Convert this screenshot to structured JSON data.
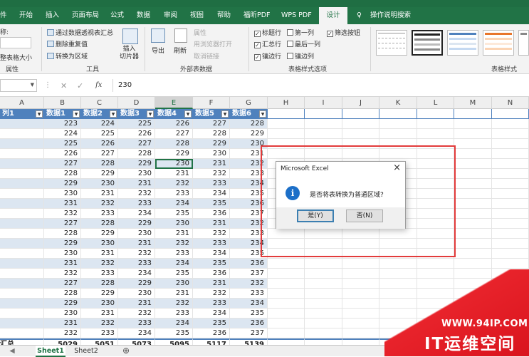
{
  "tabs": [
    {
      "label": "件"
    },
    {
      "label": "开始"
    },
    {
      "label": "插入"
    },
    {
      "label": "页面布局"
    },
    {
      "label": "公式"
    },
    {
      "label": "数据"
    },
    {
      "label": "审阅"
    },
    {
      "label": "视图"
    },
    {
      "label": "帮助"
    },
    {
      "label": "福昕PDF"
    },
    {
      "label": "WPS PDF"
    },
    {
      "label": "设计"
    }
  ],
  "tell_me": "操作说明搜索",
  "ribbon": {
    "props": {
      "name_label": "称:",
      "resize": "整表格大小",
      "group": "属性"
    },
    "tools": {
      "pivot": "通过数据透视表汇总",
      "dedupe": "删除重复值",
      "convert": "转换为区域",
      "slicer": "插入\n切片器",
      "group": "工具"
    },
    "external": {
      "export": "导出",
      "refresh": "刷新",
      "properties": "属性",
      "open_browser": "用浏览器打开",
      "unlink": "取消链接",
      "group": "外部表数据"
    },
    "options": {
      "header_row": "标题行",
      "total_row": "汇总行",
      "banded_rows": "镶边行",
      "first_col": "第一列",
      "last_col": "最后一列",
      "banded_cols": "镶边列",
      "filter_btn": "筛选按钮",
      "group": "表格样式选项"
    },
    "styles": {
      "group": "表格样式"
    }
  },
  "formula": {
    "fx": "fx",
    "value": "230"
  },
  "columns": [
    "A",
    "B",
    "C",
    "D",
    "E",
    "F",
    "G",
    "H",
    "I",
    "J",
    "K",
    "L",
    "M",
    "N"
  ],
  "selected_column": "E",
  "headers": [
    "列1",
    "数据1",
    "数据2",
    "数据3",
    "数据4",
    "数据5",
    "数据6"
  ],
  "rows": [
    [
      223,
      224,
      225,
      226,
      227,
      228
    ],
    [
      224,
      225,
      226,
      227,
      228,
      229
    ],
    [
      225,
      226,
      227,
      228,
      229,
      230
    ],
    [
      226,
      227,
      228,
      229,
      230,
      231
    ],
    [
      227,
      228,
      229,
      230,
      231,
      232
    ],
    [
      228,
      229,
      230,
      231,
      232,
      233
    ],
    [
      229,
      230,
      231,
      232,
      233,
      234
    ],
    [
      230,
      231,
      232,
      233,
      234,
      235
    ],
    [
      231,
      232,
      233,
      234,
      235,
      236
    ],
    [
      232,
      233,
      234,
      235,
      236,
      237
    ],
    [
      227,
      228,
      229,
      230,
      231,
      232
    ],
    [
      228,
      229,
      230,
      231,
      232,
      233
    ],
    [
      229,
      230,
      231,
      232,
      233,
      234
    ],
    [
      230,
      231,
      232,
      233,
      234,
      235
    ],
    [
      231,
      232,
      233,
      234,
      235,
      236
    ],
    [
      232,
      233,
      234,
      235,
      236,
      237
    ],
    [
      227,
      228,
      229,
      230,
      231,
      232
    ],
    [
      228,
      229,
      230,
      231,
      232,
      233
    ],
    [
      229,
      230,
      231,
      232,
      233,
      234
    ],
    [
      230,
      231,
      232,
      233,
      234,
      235
    ],
    [
      231,
      232,
      233,
      234,
      235,
      236
    ],
    [
      232,
      233,
      234,
      235,
      236,
      237
    ]
  ],
  "total_label": "汇总",
  "totals": [
    5029,
    5051,
    5073,
    5095,
    5117,
    5139
  ],
  "sheets": [
    "Sheet1",
    "Sheet2"
  ],
  "dialog": {
    "title": "Microsoft Excel",
    "message": "是否将表转换为普通区域?",
    "yes": "是(Y)",
    "no": "否(N)"
  },
  "watermark": {
    "url": "WWW.94IP.COM",
    "name": "IT运维空间"
  },
  "colors": {
    "excel_green": "#217346",
    "table_header": "#4f81bd",
    "band": "#dce6f1",
    "highlight_red": "#e23b3b"
  }
}
